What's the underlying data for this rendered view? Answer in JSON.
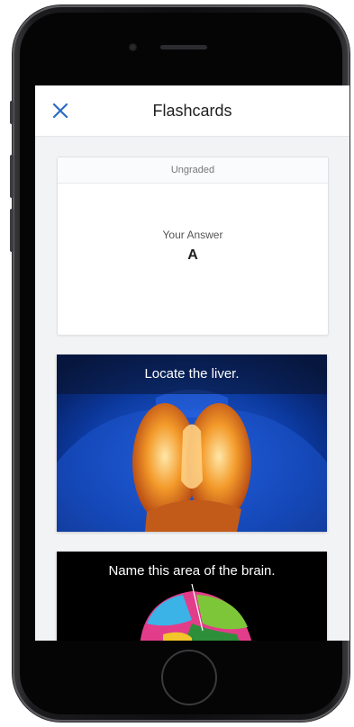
{
  "header": {
    "title": "Flashcards",
    "close_icon": "close-icon",
    "accent_color": "#2b6cc4"
  },
  "answer_card": {
    "status": "Ungraded",
    "label": "Your Answer",
    "value": "A"
  },
  "flashcards": [
    {
      "prompt": "Locate the liver.",
      "image": "anatomy-torso-organs"
    },
    {
      "prompt": "Name this area of the brain.",
      "image": "brain-regions"
    }
  ]
}
